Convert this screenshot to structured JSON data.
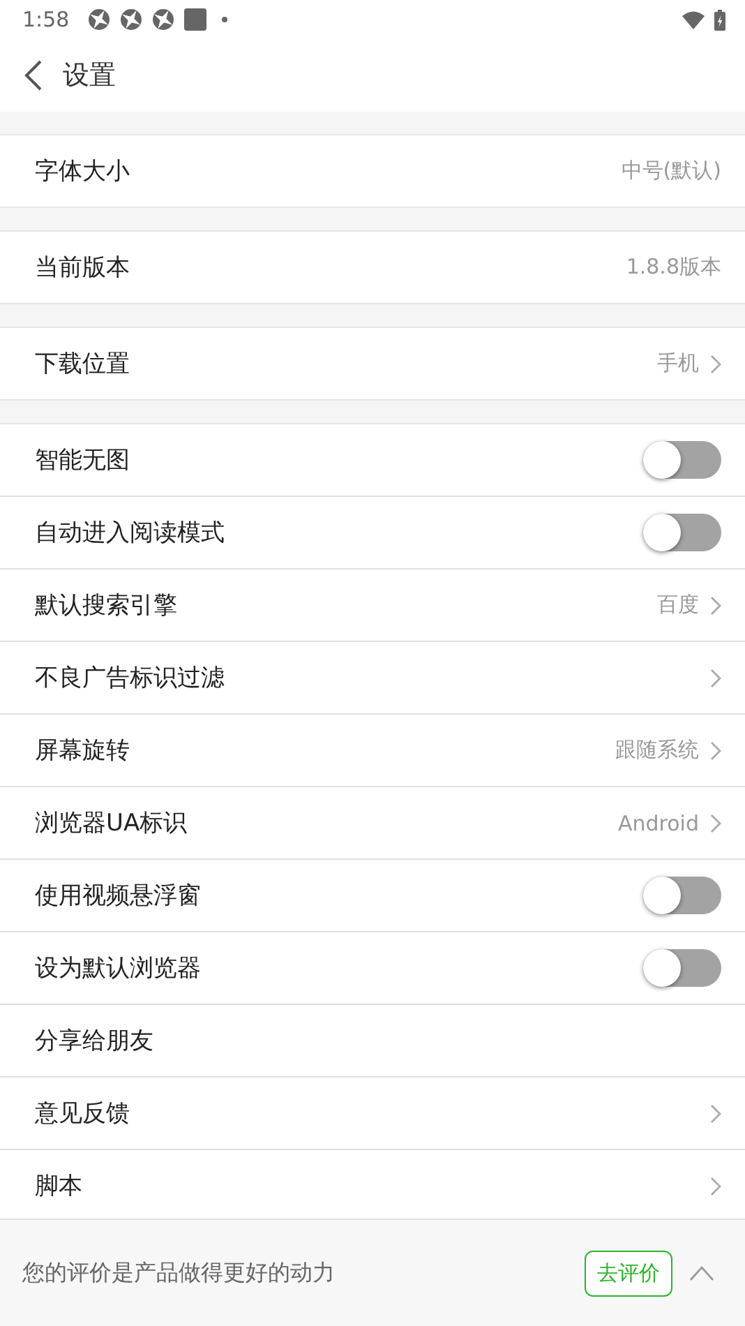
{
  "status_bar": {
    "time": "1:58"
  },
  "header": {
    "title": "设置"
  },
  "groups": [
    {
      "items": [
        {
          "kind": "value",
          "label": "字体大小",
          "value": "中号(默认)"
        }
      ]
    },
    {
      "items": [
        {
          "kind": "value",
          "label": "当前版本",
          "value": "1.8.8版本"
        }
      ]
    },
    {
      "items": [
        {
          "kind": "link",
          "label": "下载位置",
          "value": "手机"
        }
      ]
    },
    {
      "items": [
        {
          "kind": "toggle",
          "label": "智能无图",
          "on": false
        },
        {
          "kind": "toggle",
          "label": "自动进入阅读模式",
          "on": false
        },
        {
          "kind": "link",
          "label": "默认搜索引擎",
          "value": "百度"
        },
        {
          "kind": "link",
          "label": "不良广告标识过滤"
        },
        {
          "kind": "link",
          "label": "屏幕旋转",
          "value": "跟随系统"
        },
        {
          "kind": "link",
          "label": "浏览器UA标识",
          "value": "Android"
        },
        {
          "kind": "toggle",
          "label": "使用视频悬浮窗",
          "on": false
        },
        {
          "kind": "toggle",
          "label": "设为默认浏览器",
          "on": false
        },
        {
          "kind": "plain",
          "label": "分享给朋友"
        },
        {
          "kind": "link",
          "label": "意见反馈"
        },
        {
          "kind": "link",
          "label": "脚本"
        }
      ]
    }
  ],
  "rating_bar": {
    "message": "您的评价是产品做得更好的动力",
    "button": "去评价"
  }
}
